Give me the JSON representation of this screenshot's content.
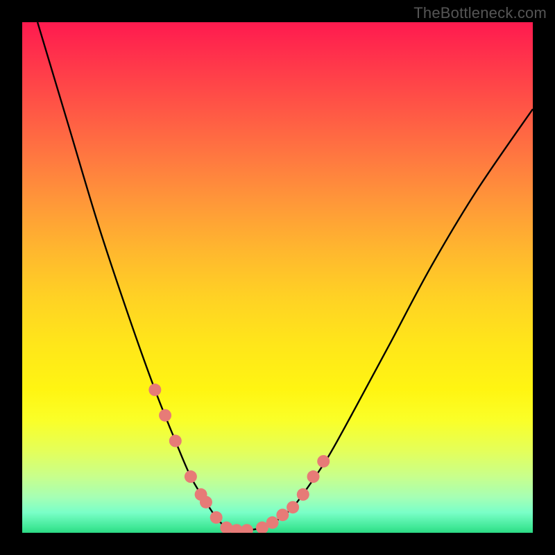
{
  "watermark": "TheBottleneck.com",
  "colors": {
    "frame": "#000000",
    "gradient_top": "#ff1a4f",
    "gradient_bottom": "#2cd884",
    "curve": "#000000",
    "dot_fill": "#e77b77",
    "dot_stroke": "#c05a56"
  },
  "chart_data": {
    "type": "line",
    "title": "",
    "xlabel": "",
    "ylabel": "",
    "xlim": [
      0,
      100
    ],
    "ylim": [
      0,
      100
    ],
    "series": [
      {
        "name": "bottleneck-curve",
        "x": [
          3,
          9,
          15,
          21,
          26,
          30,
          33,
          36,
          38,
          40,
          42,
          44,
          47,
          50,
          53,
          56,
          60,
          65,
          72,
          80,
          89,
          100
        ],
        "values": [
          100,
          80,
          60,
          42,
          28,
          18,
          11,
          6,
          3,
          1,
          0.5,
          0.5,
          1,
          2.5,
          5,
          9,
          15,
          24,
          37,
          52,
          67,
          83
        ]
      }
    ],
    "markers": {
      "name": "highlighted-points",
      "x": [
        26,
        28,
        30,
        33,
        35,
        36,
        38,
        40,
        42,
        44,
        47,
        49,
        51,
        53,
        55,
        57,
        59
      ],
      "values": [
        28,
        23,
        18,
        11,
        7.5,
        6,
        3,
        1,
        0.5,
        0.5,
        1,
        2,
        3.5,
        5,
        7.5,
        11,
        14
      ]
    }
  }
}
